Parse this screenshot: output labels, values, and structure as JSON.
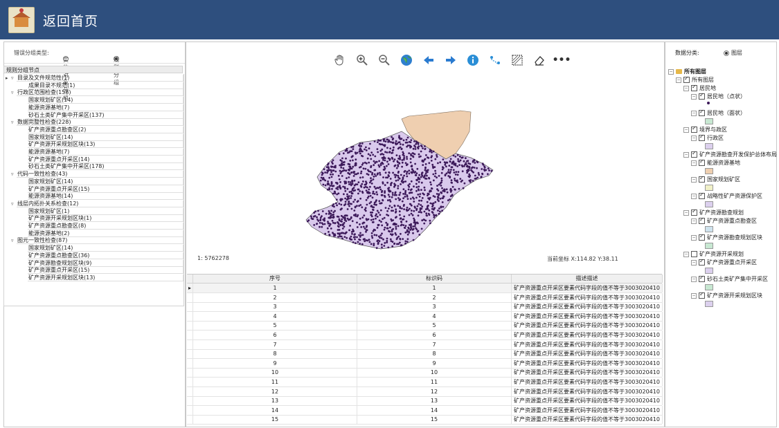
{
  "header": {
    "title": "返回首页"
  },
  "left": {
    "group_type_label": "错误分组类型:",
    "options": [
      "实体对象分组",
      "规则分组"
    ],
    "selected": "规则分组",
    "tree_header": "规则分组节点",
    "tree": [
      {
        "label": "目录及文件规范性(1)",
        "level": 0
      },
      {
        "label": "成果目录不规范(1)",
        "level": 1
      },
      {
        "label": "行政区范围检查(158)",
        "level": 0
      },
      {
        "label": "国家规划矿区(14)",
        "level": 1
      },
      {
        "label": "能源资源基地(7)",
        "level": 1
      },
      {
        "label": "砂石土类矿产集中开采区(137)",
        "level": 1
      },
      {
        "label": "数据完整性检查(228)",
        "level": 0
      },
      {
        "label": "矿产资源重点勘查区(2)",
        "level": 1
      },
      {
        "label": "国家规划矿区(14)",
        "level": 1
      },
      {
        "label": "矿产资源开采规划区块(13)",
        "level": 1
      },
      {
        "label": "能源资源基地(7)",
        "level": 1
      },
      {
        "label": "矿产资源重点开采区(14)",
        "level": 1
      },
      {
        "label": "砂石土类矿产集中开采区(178)",
        "level": 1
      },
      {
        "label": "代码一致性检查(43)",
        "level": 0
      },
      {
        "label": "国家规划矿区(14)",
        "level": 1
      },
      {
        "label": "矿产资源重点开采区(15)",
        "level": 1
      },
      {
        "label": "能源资源基地(14)",
        "level": 1
      },
      {
        "label": "线层内拓扑关系检查(12)",
        "level": 0
      },
      {
        "label": "国家规划矿区(1)",
        "level": 1
      },
      {
        "label": "矿产资源开采规划区块(1)",
        "level": 1
      },
      {
        "label": "矿产资源重点勘查区(8)",
        "level": 1
      },
      {
        "label": "能源资源基地(2)",
        "level": 1
      },
      {
        "label": "图元一致性检查(87)",
        "level": 0
      },
      {
        "label": "国家规划矿区(14)",
        "level": 1
      },
      {
        "label": "矿产资源重点勘查区(36)",
        "level": 1
      },
      {
        "label": "矿产资源勘查规划区块(9)",
        "level": 1
      },
      {
        "label": "矿产资源重点开采区(15)",
        "level": 1
      },
      {
        "label": "矿产资源开采规划区块(13)",
        "level": 1
      }
    ]
  },
  "map": {
    "toolbar": [
      "pan-icon",
      "zoom-in-icon",
      "zoom-out-icon",
      "globe-icon",
      "back-arrow-icon",
      "forward-arrow-icon",
      "info-icon",
      "route-icon",
      "select-area-icon",
      "eraser-icon",
      "more-icon"
    ],
    "scale_text": "1:  5762278",
    "coord_text": "当前坐标  X:114.82  Y:38.11",
    "colors": {
      "province": "#d9c9ec",
      "region": "#efcfb0",
      "points": "#3d1a5a"
    }
  },
  "table": {
    "columns": [
      "序号",
      "标识码",
      "描述描述"
    ],
    "rows": [
      [
        "1",
        "1",
        "矿产资源重点开采区要素代码字段的值不等于3003020410"
      ],
      [
        "2",
        "2",
        "矿产资源重点开采区要素代码字段的值不等于3003020410"
      ],
      [
        "3",
        "3",
        "矿产资源重点开采区要素代码字段的值不等于3003020410"
      ],
      [
        "4",
        "4",
        "矿产资源重点开采区要素代码字段的值不等于3003020410"
      ],
      [
        "5",
        "5",
        "矿产资源重点开采区要素代码字段的值不等于3003020410"
      ],
      [
        "6",
        "6",
        "矿产资源重点开采区要素代码字段的值不等于3003020410"
      ],
      [
        "7",
        "7",
        "矿产资源重点开采区要素代码字段的值不等于3003020410"
      ],
      [
        "8",
        "8",
        "矿产资源重点开采区要素代码字段的值不等于3003020410"
      ],
      [
        "9",
        "9",
        "矿产资源重点开采区要素代码字段的值不等于3003020410"
      ],
      [
        "10",
        "10",
        "矿产资源重点开采区要素代码字段的值不等于3003020410"
      ],
      [
        "11",
        "11",
        "矿产资源重点开采区要素代码字段的值不等于3003020410"
      ],
      [
        "12",
        "12",
        "矿产资源重点开采区要素代码字段的值不等于3003020410"
      ],
      [
        "13",
        "13",
        "矿产资源重点开采区要素代码字段的值不等于3003020410"
      ],
      [
        "14",
        "14",
        "矿产资源重点开采区要素代码字段的值不等于3003020410"
      ],
      [
        "15",
        "15",
        "矿产资源重点开采区要素代码字段的值不等于3003020410"
      ]
    ]
  },
  "right": {
    "label": "数据分类:",
    "option": "图层",
    "layers": [
      {
        "label": "所有图层",
        "level": 0,
        "folder": true,
        "checked": null,
        "swatch": null
      },
      {
        "label": "所有图层",
        "level": 1,
        "checked": true,
        "swatch": null
      },
      {
        "label": "居民地",
        "level": 2,
        "checked": true,
        "swatch": null
      },
      {
        "label": "居民地（点状）",
        "level": 3,
        "checked": true,
        "swatch": "dot"
      },
      {
        "label": "居民地（面状）",
        "level": 3,
        "checked": true,
        "swatch": "#c8e8d2"
      },
      {
        "label": "境界与政区",
        "level": 2,
        "checked": true,
        "swatch": null
      },
      {
        "label": "行政区",
        "level": 3,
        "checked": true,
        "swatch": "#dcd0ee"
      },
      {
        "label": "矿产资源勘查开发保护总体布局",
        "level": 2,
        "checked": true,
        "swatch": null
      },
      {
        "label": "能源资源基地",
        "level": 3,
        "checked": true,
        "swatch": "#efcfb0"
      },
      {
        "label": "国家规划矿区",
        "level": 3,
        "checked": true,
        "swatch": "#f1f1c8"
      },
      {
        "label": "战略性矿产资源保护区",
        "level": 3,
        "checked": true,
        "swatch": "#dcd0ee"
      },
      {
        "label": "矿产资源勘查规划",
        "level": 2,
        "checked": true,
        "swatch": null
      },
      {
        "label": "矿产资源重点勘查区",
        "level": 3,
        "checked": true,
        "swatch": "#cfe3ee"
      },
      {
        "label": "矿产资源勘查规划区块",
        "level": 3,
        "checked": true,
        "swatch": "#c8e8d2"
      },
      {
        "label": "矿产资源开采规划",
        "level": 2,
        "checked": false,
        "swatch": null
      },
      {
        "label": "矿产资源重点开采区",
        "level": 3,
        "checked": true,
        "swatch": "#dcd0ee"
      },
      {
        "label": "砂石土类矿产集中开采区",
        "level": 3,
        "checked": true,
        "swatch": "#c8e8d2"
      },
      {
        "label": "矿产资源开采规划区块",
        "level": 3,
        "checked": true,
        "swatch": "#dcd0ee"
      }
    ]
  }
}
